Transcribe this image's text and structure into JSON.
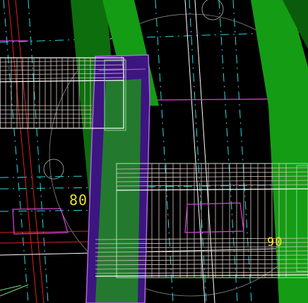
{
  "canvas": {
    "background": "#000000"
  },
  "labels": {
    "left_dimension": "80",
    "right_dimension": "90"
  },
  "colors": {
    "green_beam": "#149c14",
    "green_beam_dark": "#0a5c0a",
    "purple_column": "#3c1580",
    "purple_outline": "#b066e0",
    "wireframe": "#d8c8c0",
    "wire_white": "#ffffff",
    "cyan_axis": "#2ad8e0",
    "red_line": "#e02020",
    "magenta": "#e040e0",
    "yellow_text": "#e8e02a",
    "circle": "#c8c8c8",
    "light_green_outline": "#7ee07e"
  }
}
